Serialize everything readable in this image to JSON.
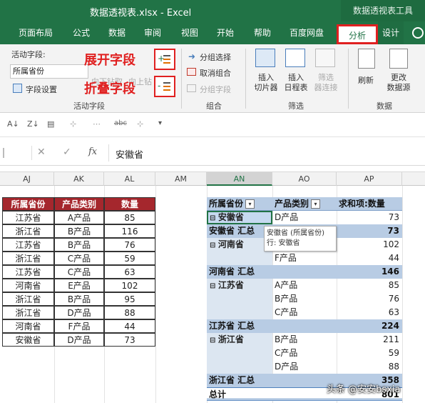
{
  "titlebar": {
    "title": "数据透视表.xlsx  -  Excel",
    "context_label": "数据透视表工具"
  },
  "tabs": [
    "页面布局",
    "公式",
    "数据",
    "审阅",
    "视图",
    "开始",
    "帮助",
    "百度网盘",
    "分析",
    "设计"
  ],
  "ribbon": {
    "active_field_label": "活动字段:",
    "active_field_value": "所属省份",
    "field_settings": "字段设置",
    "drill_down": "向下钻取",
    "drill_up": "向上钻",
    "expand_annotation": "展开字段",
    "collapse_annotation": "折叠字段",
    "group_active_field": "活动字段",
    "group_selection": "分组选择",
    "ungroup": "取消组合",
    "group_field": "分组字段",
    "group_group": "组合",
    "insert_slicer": "插入\n切片器",
    "insert_timeline": "插入\n日程表",
    "filter_connections": "筛选\n器连接",
    "group_filter": "筛选",
    "refresh": "刷新",
    "change_source": "更改\n数据源",
    "group_data": "数据"
  },
  "formula_bar": {
    "value": "安徽省"
  },
  "columns": [
    "AJ",
    "AK",
    "AL",
    "AM",
    "AN",
    "AO",
    "AP"
  ],
  "source_table": {
    "headers": [
      "所属省份",
      "产品类别",
      "数量"
    ],
    "rows": [
      [
        "江苏省",
        "A产品",
        "85"
      ],
      [
        "浙江省",
        "B产品",
        "116"
      ],
      [
        "江苏省",
        "B产品",
        "76"
      ],
      [
        "浙江省",
        "C产品",
        "59"
      ],
      [
        "江苏省",
        "C产品",
        "63"
      ],
      [
        "河南省",
        "E产品",
        "102"
      ],
      [
        "浙江省",
        "B产品",
        "95"
      ],
      [
        "浙江省",
        "D产品",
        "88"
      ],
      [
        "河南省",
        "F产品",
        "44"
      ],
      [
        "安徽省",
        "D产品",
        "73"
      ]
    ]
  },
  "pivot": {
    "headers": [
      "所属省份",
      "产品类别",
      "求和项:数量"
    ],
    "rows": [
      {
        "type": "item",
        "province": "安徽省",
        "product": "D产品",
        "value": "73"
      },
      {
        "type": "subtotal",
        "label": "安徽省 汇总",
        "value": "73"
      },
      {
        "type": "item",
        "province": "河南省",
        "product": "",
        "value": "102"
      },
      {
        "type": "item",
        "province": "",
        "product": "F产品",
        "value": "44"
      },
      {
        "type": "subtotal",
        "label": "河南省 汇总",
        "value": "146"
      },
      {
        "type": "item",
        "province": "江苏省",
        "product": "A产品",
        "value": "85"
      },
      {
        "type": "item",
        "province": "",
        "product": "B产品",
        "value": "76"
      },
      {
        "type": "item",
        "province": "",
        "product": "C产品",
        "value": "63"
      },
      {
        "type": "subtotal",
        "label": "江苏省 汇总",
        "value": "224"
      },
      {
        "type": "item",
        "province": "浙江省",
        "product": "B产品",
        "value": "211"
      },
      {
        "type": "item",
        "province": "",
        "product": "C产品",
        "value": "59"
      },
      {
        "type": "item",
        "province": "",
        "product": "D产品",
        "value": "88"
      },
      {
        "type": "subtotal",
        "label": "浙江省 汇总",
        "value": "358"
      },
      {
        "type": "total",
        "label": "总计",
        "value": "801"
      }
    ]
  },
  "tooltip": {
    "line1": "安徽省 (所属省份)",
    "line2": "行: 安徽省"
  },
  "watermark": "头条 @安安bsxia"
}
